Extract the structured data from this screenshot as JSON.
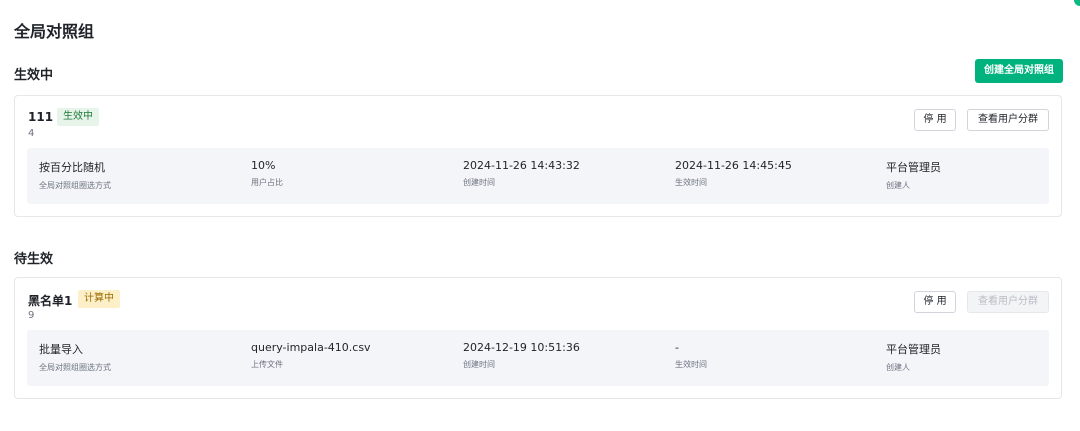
{
  "page_title": "全局对照组",
  "sections": {
    "active": {
      "title": "生效中",
      "create_button": "创建全局对照组"
    },
    "pending": {
      "title": "待生效"
    }
  },
  "cards": [
    {
      "name": "111",
      "status": "生效中",
      "count": "4",
      "stop_button": "停 用",
      "segment_button": "查看用户分群",
      "segment_button_disabled": false,
      "fields": [
        {
          "value": "按百分比随机",
          "label": "全局对照组圈选方式"
        },
        {
          "value": "10%",
          "label": "用户占比"
        },
        {
          "value": "2024-11-26 14:43:32",
          "label": "创建时间"
        },
        {
          "value": "2024-11-26 14:45:45",
          "label": "生效时间"
        },
        {
          "value": "平台管理员",
          "label": "创建人"
        }
      ]
    },
    {
      "name": "黑名单1",
      "status": "计算中",
      "count": "9",
      "stop_button": "停 用",
      "segment_button": "查看用户分群",
      "segment_button_disabled": true,
      "fields": [
        {
          "value": "批量导入",
          "label": "全局对照组圈选方式"
        },
        {
          "value": "query-impala-410.csv",
          "label": "上传文件"
        },
        {
          "value": "2024-12-19 10:51:36",
          "label": "创建时间"
        },
        {
          "value": "-",
          "label": "生效时间"
        },
        {
          "value": "平台管理员",
          "label": "创建人"
        }
      ]
    }
  ],
  "colors": {
    "primary": "#00b37e",
    "badge_active_bg": "#e6f4ea",
    "badge_calc_bg": "#fdf0c8",
    "panel_bg": "#f4f5f8"
  }
}
